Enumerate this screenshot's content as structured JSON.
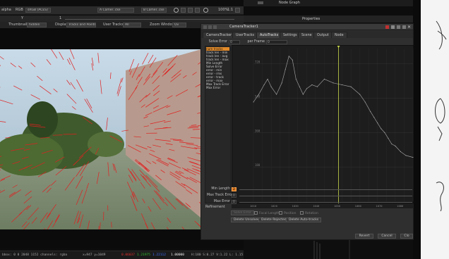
{
  "viewer": {
    "toolbar1": {
      "channel": "alpha",
      "colorspace_short": "RGB",
      "colorspace": "sRGB (ACES)",
      "camera": "A  Camer..cke",
      "input_b": "B  Camer..cke",
      "zoom": "100%",
      "proxy": "1:1",
      "gamma_label": "Y",
      "gain_value": "1"
    },
    "toolbar2": {
      "thumbnails_label": "Thumbnails",
      "thumbnails_value": "hidden",
      "display_label": "Display",
      "display_value": "Tracks and Points",
      "user_tracks_label": "User Tracks",
      "user_tracks_value": "All",
      "zoom_window_label": "Zoom Window",
      "zoom_window_value": "Ov"
    },
    "statusbar": {
      "bbox": "bbox: 0 0 2048 1152 channels: rgba",
      "coords": "x=947 y=1049",
      "red": "0.06037",
      "green": "1.21975",
      "blue": "1.22112",
      "alpha": "1.00000",
      "hsv": "H:180 S:0.27 V:1.22  L: 1.1512",
      "accent_red": "#e03030",
      "accent_green": "#30c030",
      "accent_blue": "#4070ff"
    }
  },
  "right": {
    "nodegraph_tab": "Node Graph",
    "properties_title": "Properties"
  },
  "props": {
    "node_name": "CameraTracker1",
    "tabs": [
      {
        "label": "CameraTracker"
      },
      {
        "label": "UserTracks"
      },
      {
        "label": "AutoTracks"
      },
      {
        "label": "Settings"
      },
      {
        "label": "Scene"
      },
      {
        "label": "Output"
      },
      {
        "label": "Node"
      }
    ],
    "solve_error_label": "Solve Error",
    "solve_error_value": "0",
    "per_frame_label": "per Frame",
    "per_frame_value": "0",
    "curves": [
      "num tracks",
      "track len - min",
      "track len - avg",
      "track len - max",
      "Min Length",
      "Solve Error",
      "error - min",
      "error - rms",
      "error - track",
      "error - max",
      "Max Track Error",
      "Max Error"
    ],
    "graph_yticks": [
      "720",
      "540",
      "360",
      "180"
    ],
    "graph_xticks": [
      "1010",
      "1020",
      "1030",
      "1040",
      "1050",
      "1060",
      "1070",
      "1080"
    ],
    "min_length_label": "Min Length",
    "min_length_value": "2",
    "max_track_error_label": "Max Track Error",
    "max_track_error_value": "0",
    "max_error_label": "Max Error",
    "max_error_value": "0",
    "refinement_label": "Refinement",
    "buttons_row1": {
      "solve": "Solve Error",
      "focal": "Focal Length",
      "position": "Position",
      "rotation": "Rotation"
    },
    "delete_unsolved": "Delete Unsolved",
    "delete_rejected": "Delete Rejected",
    "delete_autotracks": "Delete Auto-tracks",
    "revert": "Revert",
    "cancel": "Cancel",
    "close": "Clo"
  },
  "chart_data": {
    "type": "line",
    "x": [
      1000,
      1003,
      1006,
      1008,
      1010,
      1013,
      1016,
      1018,
      1020,
      1022,
      1024,
      1026,
      1028,
      1030,
      1033,
      1036,
      1040,
      1045,
      1050,
      1055,
      1060,
      1063,
      1066,
      1068,
      1070,
      1072,
      1074,
      1076,
      1078,
      1080,
      1083,
      1086,
      1090
    ],
    "values": [
      520,
      560,
      610,
      640,
      600,
      560,
      620,
      690,
      760,
      740,
      640,
      600,
      560,
      590,
      610,
      600,
      640,
      620,
      610,
      600,
      560,
      520,
      470,
      440,
      410,
      380,
      360,
      330,
      300,
      290,
      260,
      240,
      230
    ],
    "xlim": [
      1000,
      1090
    ],
    "ylim": [
      0,
      800
    ],
    "yticks": [
      180,
      360,
      540,
      720
    ],
    "current_frame": 1048,
    "grid": true
  }
}
